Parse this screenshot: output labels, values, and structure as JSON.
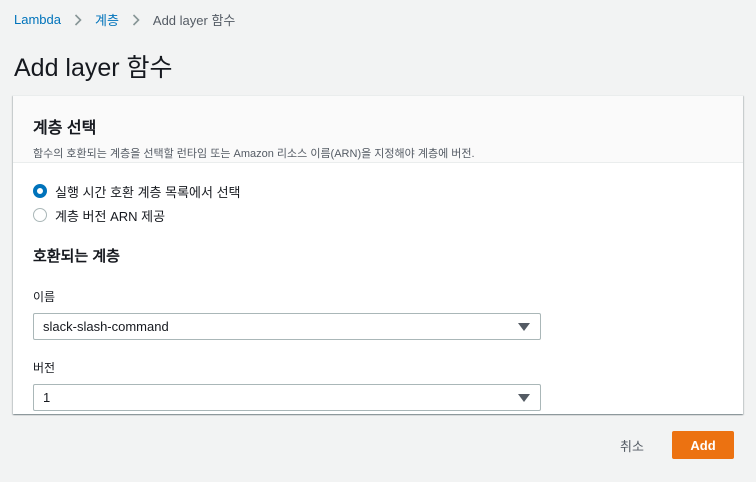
{
  "breadcrumb": {
    "items": [
      "Lambda",
      "계층"
    ],
    "current": "Add layer 함수"
  },
  "page": {
    "title": "Add layer 함수"
  },
  "panel": {
    "title": "계층 선택",
    "description": "함수의 호환되는 계층을 선택할 런타임 또는 Amazon 리소스 이름(ARN)을 지정해야 계층에 버전.",
    "radio_options": [
      {
        "label": "실행 시간 호환 계층 목록에서 선택",
        "checked": true
      },
      {
        "label": "계층 버전 ARN 제공",
        "checked": false
      }
    ],
    "compatible_layers_title": "호환되는 계층",
    "name_label": "이름",
    "name_value": "slack-slash-command",
    "version_label": "버전",
    "version_value": "1"
  },
  "footer": {
    "cancel_label": "취소",
    "add_label": "Add"
  },
  "colors": {
    "link": "#0073bb",
    "primary_button": "#ec7211",
    "radio_selected": "#0073bb",
    "background": "#f2f3f3"
  },
  "icons": {
    "separator": "chevron-right-icon",
    "dropdown": "caret-down-icon"
  }
}
